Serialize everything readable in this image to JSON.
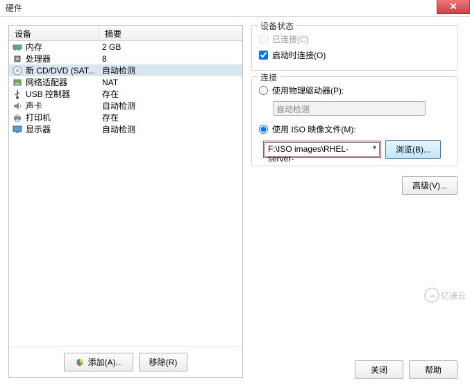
{
  "window": {
    "title": "硬件"
  },
  "list": {
    "header_device": "设备",
    "header_summary": "摘要"
  },
  "devices": [
    {
      "name": "内存",
      "summary": "2 GB",
      "icon": "memory"
    },
    {
      "name": "处理器",
      "summary": "8",
      "icon": "cpu"
    },
    {
      "name": "新 CD/DVD (SAT...",
      "summary": "自动检测",
      "icon": "cd",
      "selected": true
    },
    {
      "name": "网络适配器",
      "summary": "NAT",
      "icon": "nic"
    },
    {
      "name": "USB 控制器",
      "summary": "存在",
      "icon": "usb"
    },
    {
      "name": "声卡",
      "summary": "自动检测",
      "icon": "sound"
    },
    {
      "name": "打印机",
      "summary": "存在",
      "icon": "printer"
    },
    {
      "name": "显示器",
      "summary": "自动检测",
      "icon": "display"
    }
  ],
  "buttons": {
    "add": "添加(A)...",
    "remove": "移除(R)",
    "browse": "浏览(B)...",
    "advanced": "高级(V)...",
    "close": "关闭",
    "help": "帮助"
  },
  "status_group": {
    "title": "设备状态",
    "connected": "已连接(C)",
    "connect_poweron": "启动时连接(O)"
  },
  "connection_group": {
    "title": "连接",
    "use_physical": "使用物理驱动器(P):",
    "physical_combo": "自动检测",
    "use_iso": "使用 ISO 映像文件(M):",
    "iso_path": "F:\\ISO images\\RHEL-server-"
  },
  "watermark": "亿速云"
}
